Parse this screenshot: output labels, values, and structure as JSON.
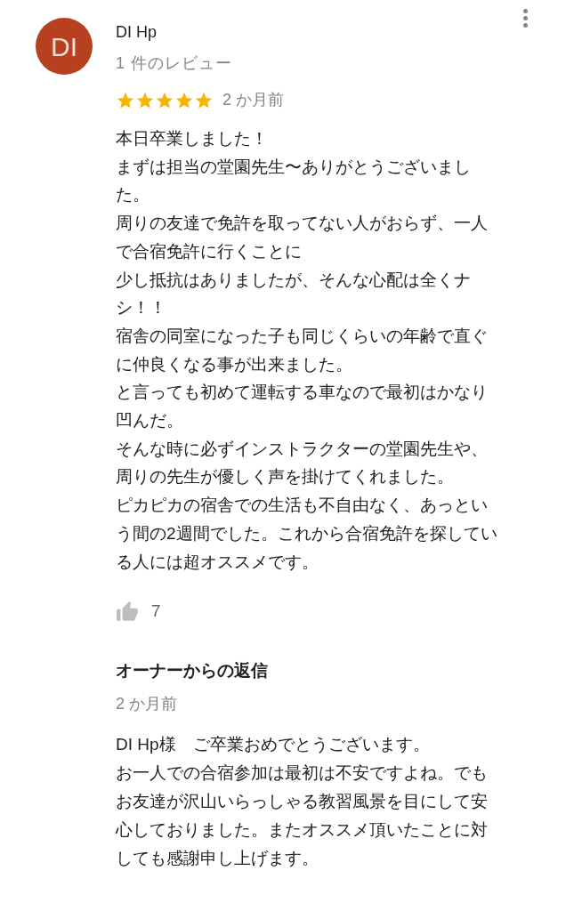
{
  "review": {
    "avatar_initials": "DI",
    "author": "DI Hp",
    "review_count": "1 件のレビュー",
    "stars": 5,
    "date": "2 か月前",
    "text_lines": [
      "本日卒業しました！",
      "まずは担当の堂園先生〜ありがとうございまし",
      "た。",
      "周りの友達で免許を取ってない人がおらず、一人",
      "で合宿免許に行くことに",
      "少し抵抗はありましたが、そんな心配は全くナ",
      "シ！！",
      "宿舎の同室になった子も同じくらいの年齢で直ぐ",
      "に仲良くなる事が出来ました。",
      "と言っても初めて運転する車なので最初はかなり",
      "凹んだ。",
      "そんな時に必ずインストラクターの堂園先生や、",
      "周りの先生が優しく声を掛けてくれました。",
      "ピカピカの宿舎での生活も不自由なく、あっとい",
      "う間の2週間でした。これから合宿免許を探してい",
      "る人には超オススメです。"
    ],
    "likes": "7"
  },
  "owner_reply": {
    "heading": "オーナーからの返信",
    "date": "2 か月前",
    "text_lines": [
      "DI Hp様　ご卒業おめでとうございます。",
      "お一人での合宿参加は最初は不安ですよね。でも",
      "お友達が沢山いらっしゃる教習風景を目にして安",
      "心しておりました。またオススメ頂いたことに対",
      "しても感謝申し上げます。"
    ]
  }
}
